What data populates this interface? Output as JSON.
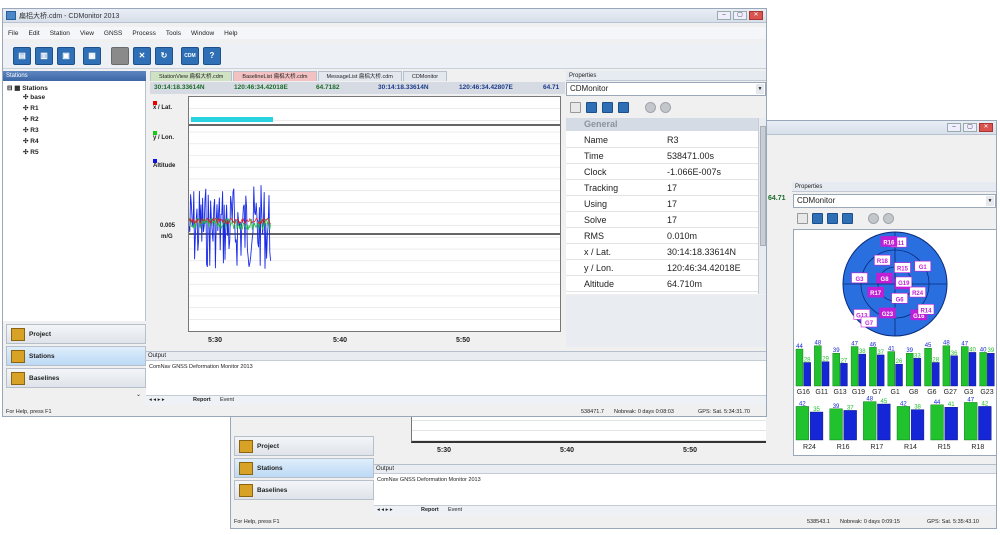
{
  "win1": {
    "title": "扁梠大桥.cdm - CDMonitor 2013",
    "menu": [
      "File",
      "Edit",
      "Station",
      "View",
      "GNSS",
      "Process",
      "Tools",
      "Window",
      "Help"
    ],
    "stations_title": "Stations",
    "tree": {
      "root": "Stations",
      "items": [
        "base",
        "R1",
        "R2",
        "R3",
        "R4",
        "R5"
      ]
    },
    "nav": [
      "Project",
      "Stations",
      "Baselines"
    ],
    "tabs": [
      "StationView 扁梠大桥.cdm",
      "BaselineList 扁梠大桥.cdm",
      "MessageList 扁梠大桥.cdm",
      "CDMonitor"
    ],
    "coords": {
      "lat": "30:14:18.33614N",
      "lon": "120:46:34.42018E",
      "alt": "64.7182",
      "lat2": "30:14:18.33614N",
      "lon2": "120:46:34.42807E",
      "alt2": "64.71"
    },
    "legend": [
      "x / Lat.",
      "y / Lon.",
      "Altitude"
    ],
    "scale": {
      "value": "0.005",
      "unit": "m/G"
    },
    "x_ticks": [
      "5:30",
      "5:40",
      "5:50"
    ],
    "properties": {
      "title": "Properties",
      "select": "CDMonitor",
      "section": "General",
      "rows": [
        {
          "k": "Name",
          "v": "R3"
        },
        {
          "k": "Time",
          "v": "538471.00s"
        },
        {
          "k": "Clock",
          "v": "-1.066E-007s"
        },
        {
          "k": "Tracking",
          "v": "17"
        },
        {
          "k": "Using",
          "v": "17"
        },
        {
          "k": "Solve",
          "v": "17"
        },
        {
          "k": "RMS",
          "v": "0.010m"
        },
        {
          "k": "x / Lat.",
          "v": " 30:14:18.33614N"
        },
        {
          "k": "y / Lon.",
          "v": "120:46:34.42018E"
        },
        {
          "k": "Altitude",
          "v": "64.710m"
        }
      ]
    },
    "output": {
      "title": "Output",
      "text": "ComNav GNSS Deformation Monitor 2013",
      "tabs": [
        "Report",
        "Event"
      ]
    },
    "status": {
      "help": "For Help, press F1",
      "time": "538471.7",
      "nobreak": "Nobreak: 0 days  0:08:03",
      "gps": "GPS: Sat.  5:34:31.70"
    }
  },
  "win2": {
    "properties": {
      "title": "Properties",
      "select": "CDMonitor"
    },
    "coord_partial": "64.71",
    "nav": [
      "Project",
      "Stations",
      "Baselines"
    ],
    "x_ticks": [
      "5:30",
      "5:40",
      "5:50"
    ],
    "output": {
      "title": "Output",
      "text": "ComNav GNSS Deformation Monitor 2013",
      "tabs": [
        "Report",
        "Event"
      ]
    },
    "status": {
      "help": "For Help, press F1",
      "time": "538543.1",
      "nobreak": "Nobreak: 0 days  0:09:15",
      "gps": "GPS: Sat.  5:35:43.10"
    },
    "sats_top": [
      {
        "name": "G16",
        "a": "44",
        "b": "28"
      },
      {
        "name": "G11",
        "a": "48",
        "b": "29"
      },
      {
        "name": "G13",
        "a": "39",
        "b": "27"
      },
      {
        "name": "G19",
        "a": "47",
        "b": "38"
      },
      {
        "name": "G7",
        "a": "46",
        "b": "37"
      },
      {
        "name": "G1",
        "a": "41",
        "b": "26"
      },
      {
        "name": "G8",
        "a": "39",
        "b": "33"
      },
      {
        "name": "G6",
        "a": "45",
        "b": "28"
      },
      {
        "name": "G27",
        "a": "48",
        "b": "36"
      },
      {
        "name": "G3",
        "a": "47",
        "b": "40"
      },
      {
        "name": "G23",
        "a": "40",
        "b": "39"
      }
    ],
    "sats_bottom": [
      {
        "name": "R24",
        "a": "42",
        "b": "35"
      },
      {
        "name": "R16",
        "a": "39",
        "b": "37"
      },
      {
        "name": "R17",
        "a": "48",
        "b": "45"
      },
      {
        "name": "R14",
        "a": "42",
        "b": "38"
      },
      {
        "name": "R15",
        "a": "44",
        "b": "41"
      },
      {
        "name": "R18",
        "a": "47",
        "b": "42"
      }
    ],
    "sky_labels": [
      "G27",
      "G13",
      "G11",
      "G16",
      "G3",
      "G1",
      "G23",
      "R18",
      "R24",
      "R17",
      "R15",
      "G6",
      "G8",
      "G19",
      "G7",
      "R16",
      "R14"
    ]
  }
}
